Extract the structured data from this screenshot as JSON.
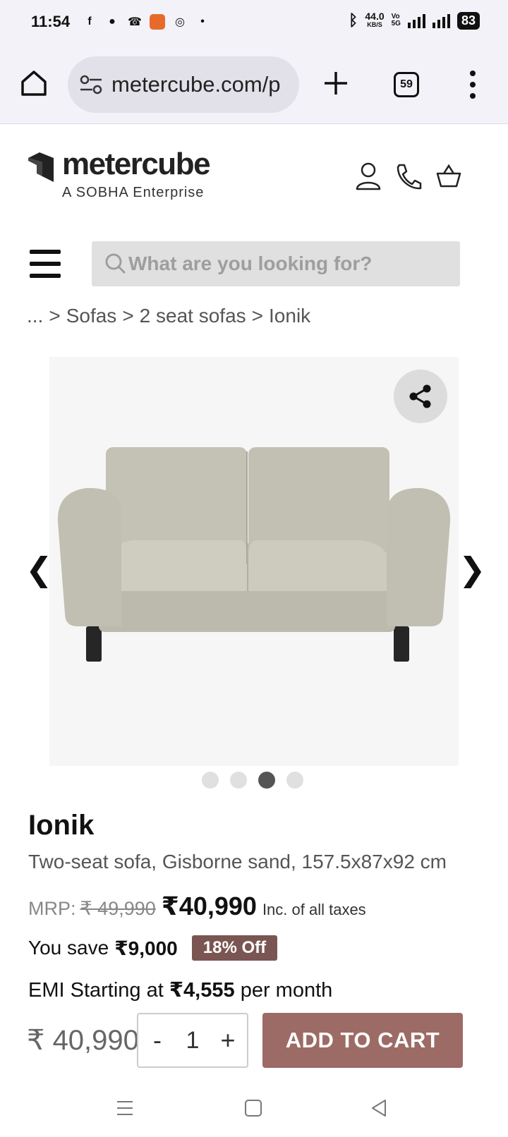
{
  "status_bar": {
    "time": "11:54",
    "net_speed": "44.0",
    "net_unit": "KB/S",
    "battery": "83"
  },
  "browser": {
    "url": "metercube.com/p",
    "tab_count": "59"
  },
  "header": {
    "brand": "metercube",
    "tagline": "A SOBHA Enterprise"
  },
  "search": {
    "placeholder": "What are you looking for?"
  },
  "breadcrumb": {
    "items": [
      "...",
      ">",
      "Sofas",
      ">",
      "2 seat sofas",
      ">",
      "Ionik"
    ]
  },
  "gallery": {
    "prev_arrow": "❮",
    "next_arrow": "❯",
    "total_images": 4,
    "active_index": 2
  },
  "product": {
    "name": "Ionik",
    "description": "Two-seat sofa, Gisborne sand, 157.5x87x92 cm",
    "mrp_label": "MRP:",
    "mrp_value": "₹ 49,990",
    "price": "₹40,990",
    "tax_note": "Inc. of all taxes",
    "save_label": "You save",
    "save_value": "₹9,000",
    "discount_badge": "18% Off",
    "emi_prefix": "EMI Starting at",
    "emi_value": "₹4,555",
    "emi_suffix": "per month"
  },
  "cart_bar": {
    "total": "₹ 40,990",
    "decrement": "-",
    "quantity": "1",
    "increment": "+",
    "add_to_cart": "ADD TO CART"
  },
  "colors": {
    "accent": "#9c6b66",
    "badge": "#7a5552",
    "chrome": "#f3f2f8"
  }
}
